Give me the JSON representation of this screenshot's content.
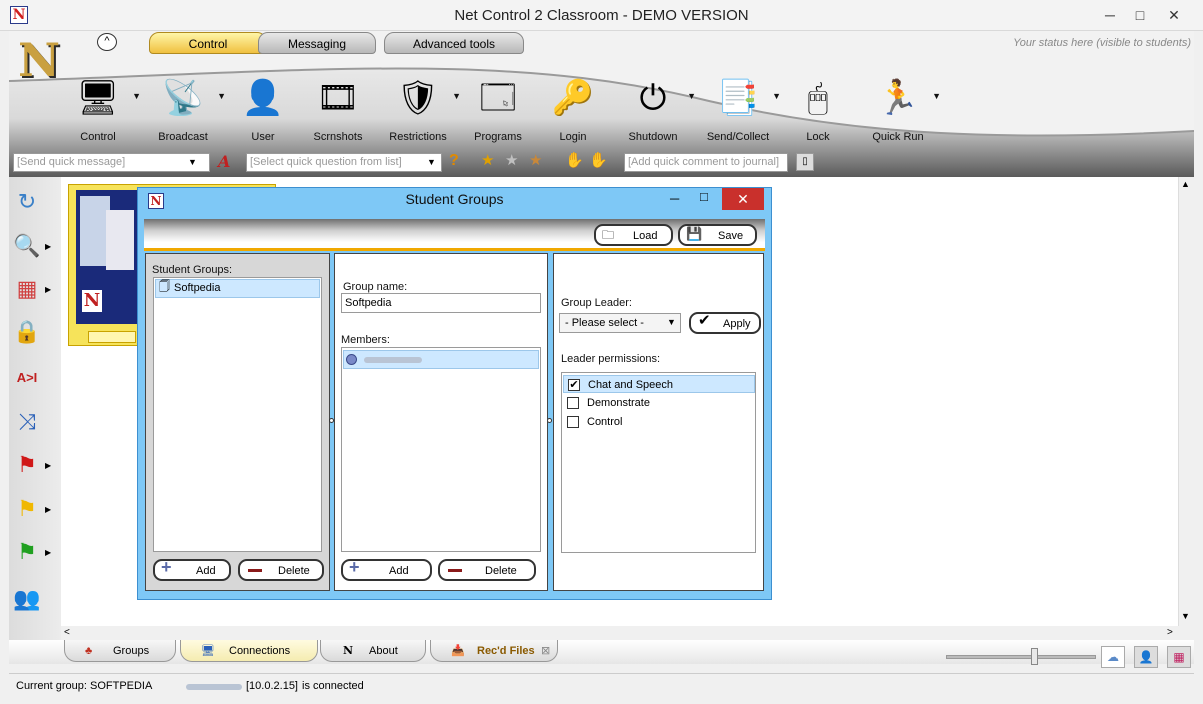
{
  "window": {
    "title": "Net Control 2 Classroom - DEMO VERSION",
    "minimize": "─",
    "maximize": "□",
    "close": "✕"
  },
  "ribbon": {
    "tabs": [
      "Control",
      "Messaging",
      "Advanced tools"
    ],
    "active_tab": "Control",
    "status_hint": "Your status here (visible to students)",
    "tools": [
      {
        "label": "Control",
        "icon": "monitor-icon",
        "glyph": "🖥",
        "has_menu": true
      },
      {
        "label": "Broadcast",
        "icon": "broadcast-icon",
        "glyph": "📡",
        "has_menu": true
      },
      {
        "label": "User",
        "icon": "user-icon",
        "glyph": "👤",
        "has_menu": false
      },
      {
        "label": "Scrnshots",
        "icon": "filmstrip-icon",
        "glyph": "🎞",
        "has_menu": false
      },
      {
        "label": "Restrictions",
        "icon": "ie-shield-icon",
        "glyph": "🛡",
        "has_menu": true
      },
      {
        "label": "Programs",
        "icon": "window-icon",
        "glyph": "🗔",
        "has_menu": false
      },
      {
        "label": "Login",
        "icon": "keys-icon",
        "glyph": "🔑",
        "has_menu": false
      },
      {
        "label": "Shutdown",
        "icon": "power-icon",
        "glyph": "⏻",
        "has_menu": true
      },
      {
        "label": "Send/Collect",
        "icon": "documents-icon",
        "glyph": "📑",
        "has_menu": true
      },
      {
        "label": "Lock",
        "icon": "mouse-lock-icon",
        "glyph": "🖱",
        "has_menu": false
      },
      {
        "label": "Quick Run",
        "icon": "quick-run-icon",
        "glyph": "🏃",
        "has_menu": true
      }
    ],
    "quick_message_placeholder": "[Send quick message]",
    "quick_question_placeholder": "[Select quick question from list]",
    "journal_placeholder": "[Add quick comment to journal]"
  },
  "sidebar": {
    "icons": [
      {
        "name": "refresh-icon",
        "glyph": "↻",
        "arrow": false
      },
      {
        "name": "monitor-search-icon",
        "glyph": "🔍",
        "arrow": true
      },
      {
        "name": "layout-icon",
        "glyph": "▦",
        "arrow": true
      },
      {
        "name": "padlock-icon",
        "glyph": "🔒",
        "arrow": false
      },
      {
        "name": "text-tool-icon",
        "glyph": "A>I",
        "arrow": false
      },
      {
        "name": "shuffle-icon",
        "glyph": "⤨",
        "arrow": false
      },
      {
        "name": "red-flag-icon",
        "glyph": "⚑",
        "arrow": true,
        "color": "#d01818"
      },
      {
        "name": "yellow-flag-icon",
        "glyph": "⚑",
        "arrow": true,
        "color": "#f0b800"
      },
      {
        "name": "green-flag-icon",
        "glyph": "⚑",
        "arrow": true,
        "color": "#20a020"
      },
      {
        "name": "group-users-icon",
        "glyph": "👥",
        "arrow": false
      }
    ]
  },
  "dialog": {
    "title": "Student Groups",
    "load_label": "Load",
    "save_label": "Save",
    "groups_label": "Student Groups:",
    "groups": [
      "Softpedia"
    ],
    "group_name_label": "Group name:",
    "group_name_value": "Softpedia",
    "members_label": "Members:",
    "group_leader_label": "Group Leader:",
    "leader_select": "- Please select -",
    "apply_label": "Apply",
    "leader_permissions_label": "Leader permissions:",
    "permissions": [
      {
        "label": "Chat and Speech",
        "checked": true
      },
      {
        "label": "Demonstrate",
        "checked": false
      },
      {
        "label": "Control",
        "checked": false
      }
    ],
    "add_label": "Add",
    "delete_label": "Delete"
  },
  "bottom_tabs": [
    "Groups",
    "Connections",
    "About",
    "Rec'd Files"
  ],
  "active_bottom_tab": "Connections",
  "status": {
    "current_group": "Current group: SOFTPEDIA",
    "ip": "[10.0.2.15]",
    "connected": "is connected"
  },
  "colors": {
    "accent_orange": "#f0a800",
    "dialog_frame": "#7ec8f6",
    "close_red": "#c9302c"
  }
}
